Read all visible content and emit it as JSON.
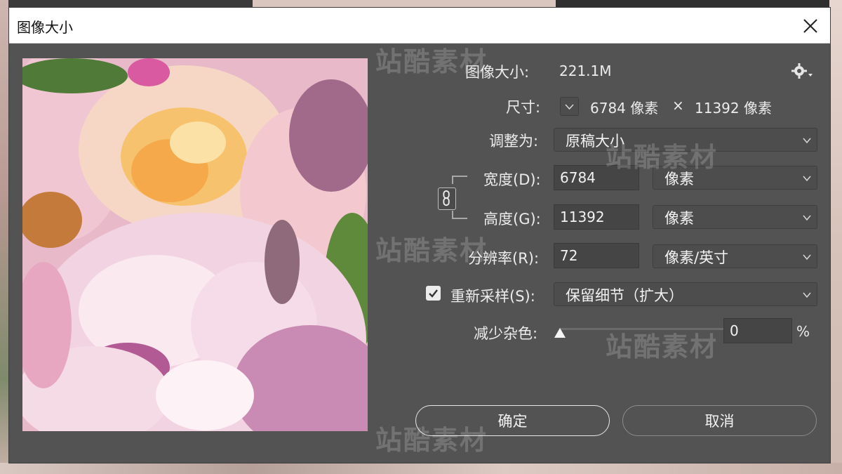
{
  "dialog": {
    "title": "图像大小",
    "close_glyph": "✕"
  },
  "info": {
    "image_size_label": "图像大小:",
    "image_size_value": "221.1M",
    "dimensions_label": "尺寸:",
    "width_px": "6784 像素",
    "times": "×",
    "height_px": "11392 像素"
  },
  "fit_to": {
    "label": "调整为:",
    "value": "原稿大小"
  },
  "width": {
    "label": "宽度(D):",
    "value": "6784",
    "unit": "像素"
  },
  "height": {
    "label": "高度(G):",
    "value": "11392",
    "unit": "像素"
  },
  "resolution": {
    "label": "分辨率(R):",
    "value": "72",
    "unit": "像素/英寸"
  },
  "resample": {
    "checked": true,
    "label": "重新采样(S):",
    "value": "保留细节（扩大）"
  },
  "reduce_noise": {
    "label": "减少杂色:",
    "value": "0",
    "unit": "%",
    "level": 0
  },
  "buttons": {
    "ok": "确定",
    "cancel": "取消"
  },
  "watermark": {
    "text": "站酷素材"
  },
  "icons": [
    "close-icon",
    "gear-icon",
    "link-icon",
    "chevron-down-icon",
    "checkbox-check-icon",
    "slider-triangle-icon"
  ],
  "colors": {
    "dialog_bg": "#535353",
    "field_bg": "#454545",
    "text": "#ececec"
  }
}
